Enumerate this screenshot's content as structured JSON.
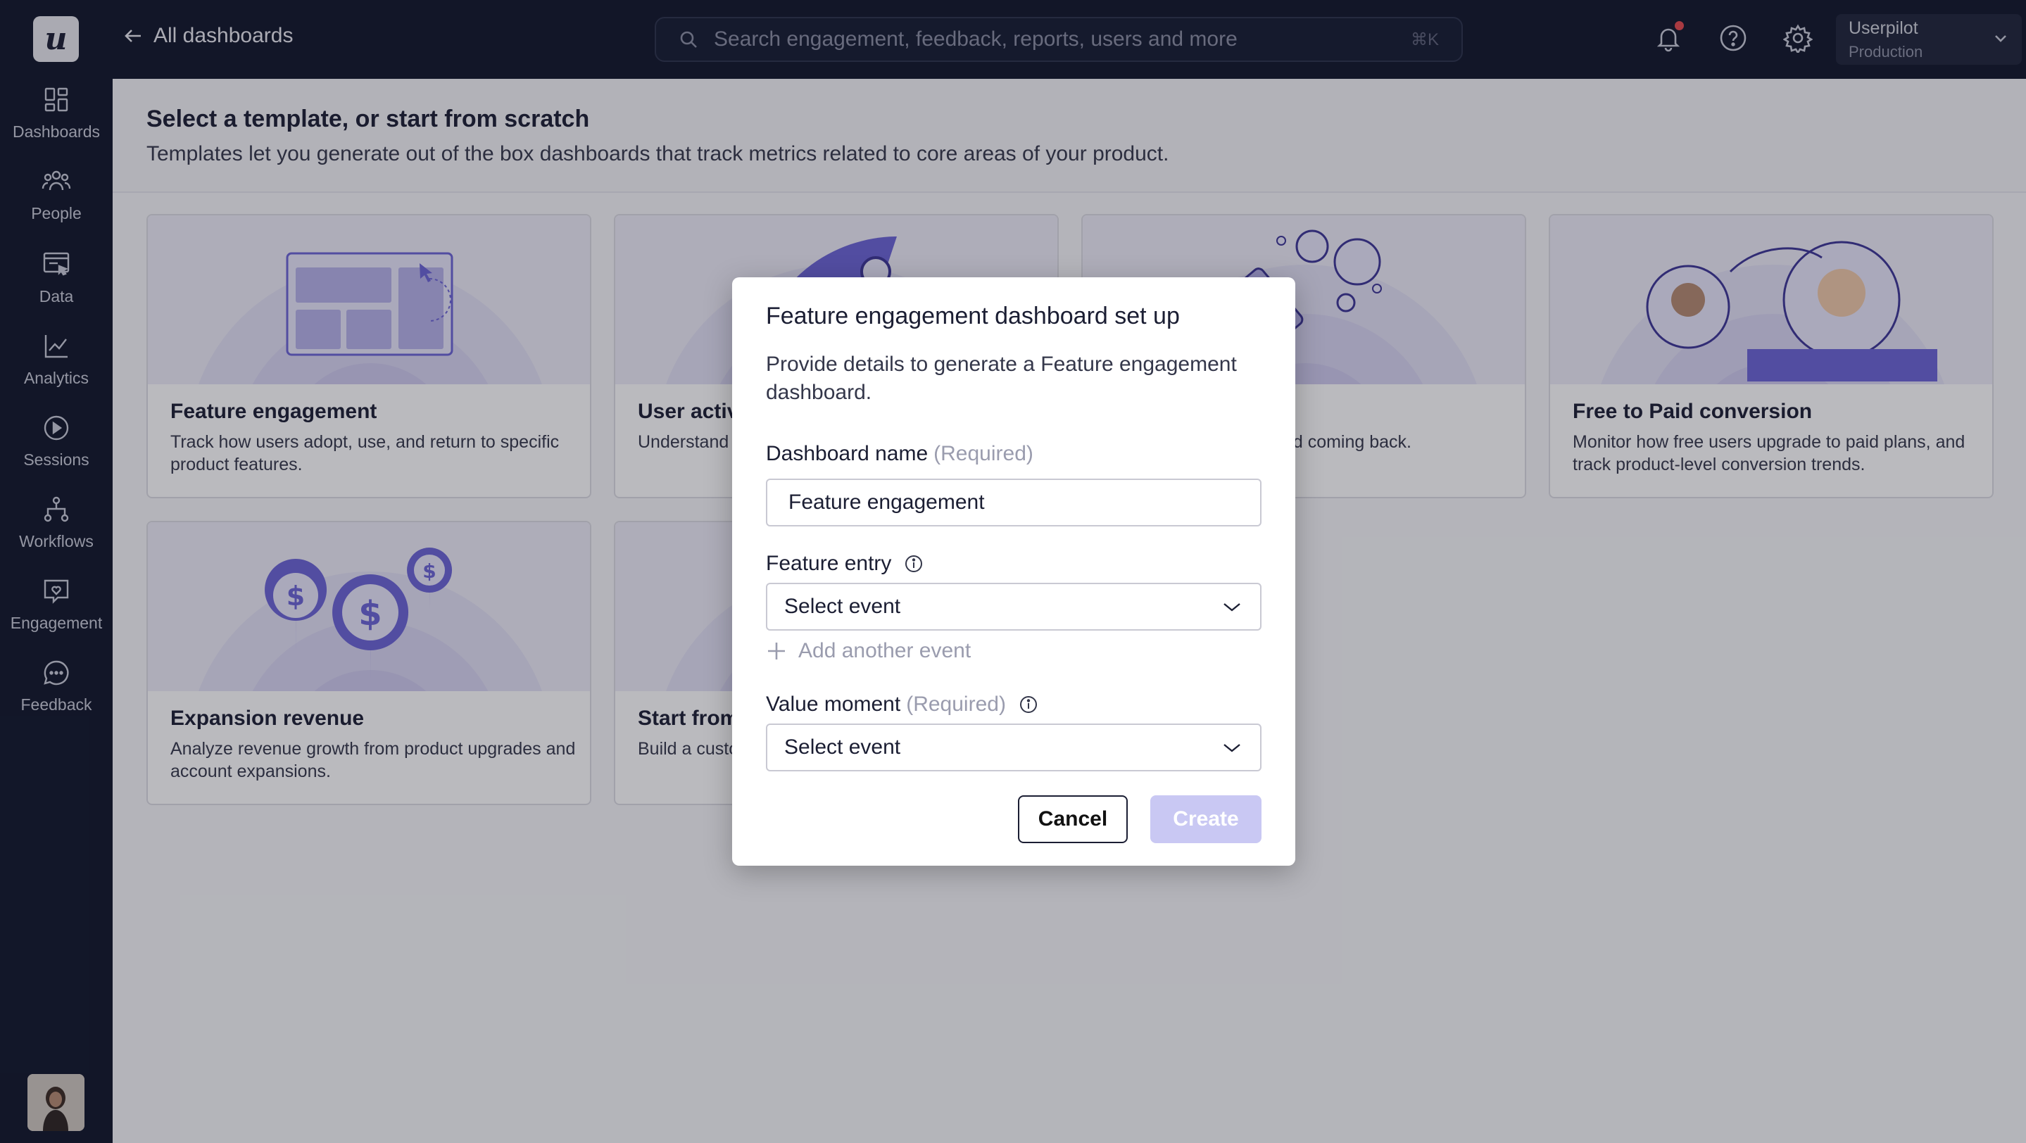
{
  "app": {
    "logo_letter": "u",
    "back_label": "All dashboards",
    "search_placeholder": "Search engagement, feedback, reports, users and more",
    "search_shortcut": "⌘K",
    "account_name": "Userpilot",
    "account_env": "Production"
  },
  "sidebar": {
    "items": [
      {
        "label": "Dashboards",
        "icon": "dashboards-icon"
      },
      {
        "label": "People",
        "icon": "people-icon"
      },
      {
        "label": "Data",
        "icon": "data-icon"
      },
      {
        "label": "Analytics",
        "icon": "analytics-icon"
      },
      {
        "label": "Sessions",
        "icon": "sessions-icon"
      },
      {
        "label": "Workflows",
        "icon": "workflows-icon"
      },
      {
        "label": "Engagement",
        "icon": "engagement-icon"
      },
      {
        "label": "Feedback",
        "icon": "feedback-icon"
      }
    ]
  },
  "page": {
    "title": "Select a template, or start from scratch",
    "subtitle": "Templates let you generate out of the box dashboards that track metrics related to core areas of your product."
  },
  "cards": [
    {
      "title": "Feature engagement",
      "desc": "Track how users adopt, use, and return to specific product features."
    },
    {
      "title": "User activ",
      "desc": "Understand product eng"
    },
    {
      "title": "",
      "desc": "luct usage, retention, and coming back."
    },
    {
      "title": "Free to Paid conversion",
      "desc": "Monitor how free users upgrade to paid plans, and track product-level conversion trends."
    },
    {
      "title": "Expansion revenue",
      "desc": "Analyze revenue growth from product upgrades and account expansions."
    },
    {
      "title": "Start from",
      "desc": "Build a custo tailored to y"
    }
  ],
  "modal": {
    "title": "Feature engagement dashboard set up",
    "description": "Provide details to generate a Feature engagement dashboard.",
    "dashboard_name_label": "Dashboard name",
    "required_text": "(Required)",
    "dashboard_name_value": "Feature engagement",
    "feature_entry_label": "Feature entry",
    "feature_entry_value": "Select event",
    "add_event_label": "Add another event",
    "value_moment_label": "Value moment",
    "value_moment_value": "Select event",
    "cancel_label": "Cancel",
    "create_label": "Create"
  },
  "colors": {
    "nav_bg": "#0f1529",
    "accent": "#6b63d6",
    "create_disabled": "#c9c8f3",
    "notification_dot": "#e5484d"
  }
}
